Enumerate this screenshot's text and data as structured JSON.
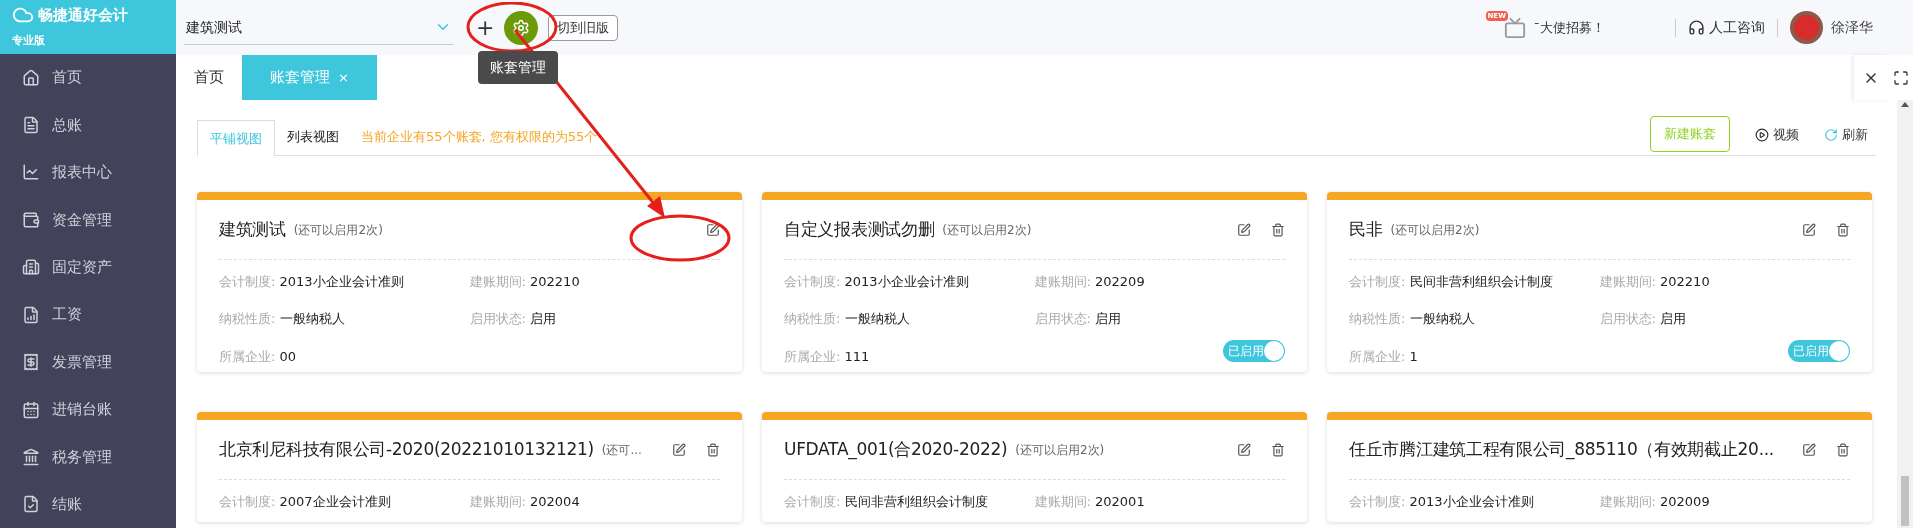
{
  "brand": {
    "name": "畅捷通好会计",
    "edition": "专业版"
  },
  "sidebar": {
    "items": [
      {
        "label": "首页",
        "selected": false
      },
      {
        "label": "总账",
        "selected": false
      },
      {
        "label": "报表中心",
        "selected": false
      },
      {
        "label": "资金管理",
        "selected": false
      },
      {
        "label": "固定资产",
        "selected": false
      },
      {
        "label": "工资",
        "selected": false
      },
      {
        "label": "发票管理",
        "selected": false
      },
      {
        "label": "进销台账",
        "selected": false
      },
      {
        "label": "税务管理",
        "selected": false
      },
      {
        "label": "结账",
        "selected": false
      }
    ]
  },
  "header": {
    "account_select": "建筑测试",
    "add": "+",
    "tooltip": "账套管理",
    "old_version_button": "切到旧版",
    "new_badge": "NEW",
    "promo": "ˉ大使招募！",
    "support": "人工咨询",
    "user": "徐泽华"
  },
  "page_tabs": [
    {
      "label": "首页",
      "selected": false,
      "closable": false
    },
    {
      "label": "账套管理",
      "selected": true,
      "closable": true
    }
  ],
  "page_tab_close": "×",
  "view_tabs": [
    {
      "label": "平铺视图",
      "selected": true
    },
    {
      "label": "列表视图",
      "selected": false
    }
  ],
  "notice": "当前企业有55个账套, 您有权限的为55个",
  "actions": {
    "new_button": "新建账套",
    "video": "视频",
    "refresh": "刷新"
  },
  "cards": [
    {
      "title": "建筑测试",
      "note": "(还可以启用2次)",
      "deletable": false,
      "fields": [
        {
          "label": "会计制度:",
          "value": "2013小企业会计准则"
        },
        {
          "label": "建账期间:",
          "value": "202210"
        },
        {
          "label": "纳税性质:",
          "value": "一般纳税人"
        },
        {
          "label": "启用状态:",
          "value": "启用"
        },
        {
          "label": "所属企业:",
          "value": "00"
        }
      ]
    },
    {
      "title": "自定义报表测试勿删",
      "note": "(还可以启用2次)",
      "deletable": true,
      "switch": {
        "label": "已启用",
        "on": true
      },
      "fields": [
        {
          "label": "会计制度:",
          "value": "2013小企业会计准则"
        },
        {
          "label": "建账期间:",
          "value": "202209"
        },
        {
          "label": "纳税性质:",
          "value": "一般纳税人"
        },
        {
          "label": "启用状态:",
          "value": "启用"
        },
        {
          "label": "所属企业:",
          "value": "111"
        }
      ]
    },
    {
      "title": "民非",
      "note": "(还可以启用2次)",
      "deletable": true,
      "switch": {
        "label": "已启用",
        "on": true
      },
      "fields": [
        {
          "label": "会计制度:",
          "value": "民间非营利组织会计制度"
        },
        {
          "label": "建账期间:",
          "value": "202210"
        },
        {
          "label": "纳税性质:",
          "value": "一般纳税人"
        },
        {
          "label": "启用状态:",
          "value": "启用"
        },
        {
          "label": "所属企业:",
          "value": "1"
        }
      ]
    },
    {
      "title": "北京利尼科技有限公司-2020(20221010132121)",
      "note": "(还可...",
      "deletable": true,
      "fields": [
        {
          "label": "会计制度:",
          "value": "2007企业会计准则"
        },
        {
          "label": "建账期间:",
          "value": "202004"
        }
      ]
    },
    {
      "title": "UFDATA_001(合2020-2022)",
      "note": "(还可以启用2次)",
      "deletable": true,
      "fields": [
        {
          "label": "会计制度:",
          "value": "民间非营利组织会计制度"
        },
        {
          "label": "建账期间:",
          "value": "202001"
        }
      ]
    },
    {
      "title": "任丘市腾江建筑工程有限公司_885110（有效期截止20...",
      "deletable": true,
      "fields": [
        {
          "label": "会计制度:",
          "value": "2013小企业会计准则"
        },
        {
          "label": "建账期间:",
          "value": "202009"
        }
      ]
    }
  ]
}
